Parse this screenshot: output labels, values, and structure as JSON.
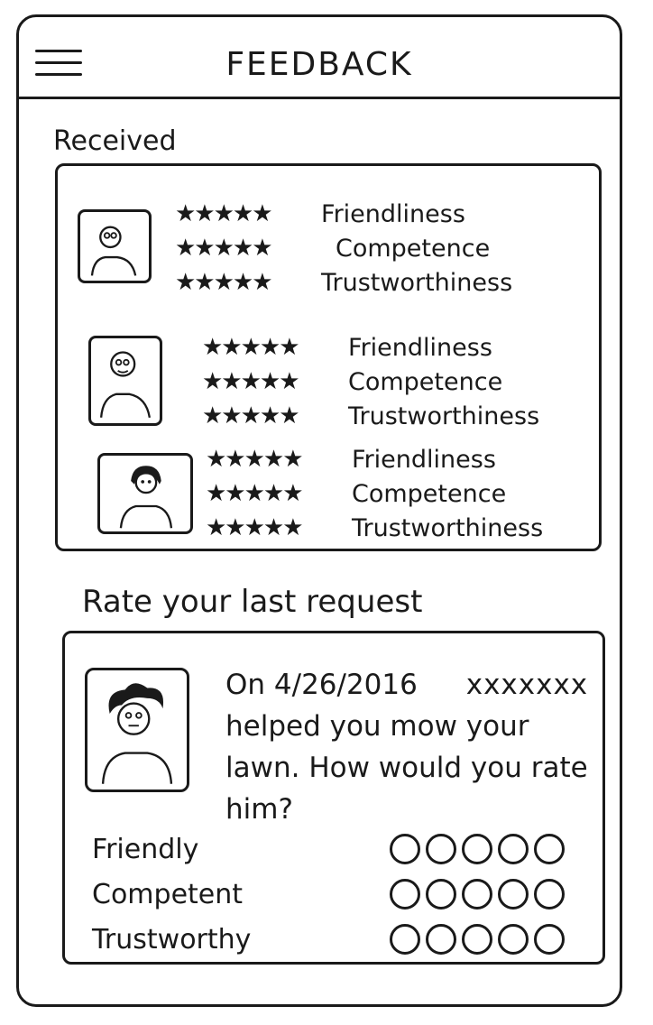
{
  "header": {
    "title": "FEEDBACK"
  },
  "received": {
    "label": "Received",
    "reviews": [
      {
        "stars": "★★★★★",
        "friendliness": "Friendliness",
        "competence": "Competence",
        "trustworthiness": "Trustworthiness"
      },
      {
        "stars": "★★★★★",
        "friendliness": "Friendliness",
        "competence": "Competence",
        "trustworthiness": "Trustworthiness"
      },
      {
        "stars": "★★★★★",
        "friendliness": "Friendliness",
        "competence": "Competence",
        "trustworthiness": "Trustworthiness"
      }
    ]
  },
  "rate": {
    "label": "Rate your last request",
    "message_prefix": "On 4/26/2016",
    "redacted_name": "xxxxxxx",
    "message_body": "helped you mow your lawn. How would you rate him?",
    "criteria": [
      "Friendly",
      "Competent",
      "Trustworthy"
    ],
    "options_count": 5
  },
  "icons": {
    "menu": "hamburger-menu-icon",
    "avatar": "person-avatar-icon",
    "star": "star-icon",
    "radio": "radio-circle-icon"
  }
}
